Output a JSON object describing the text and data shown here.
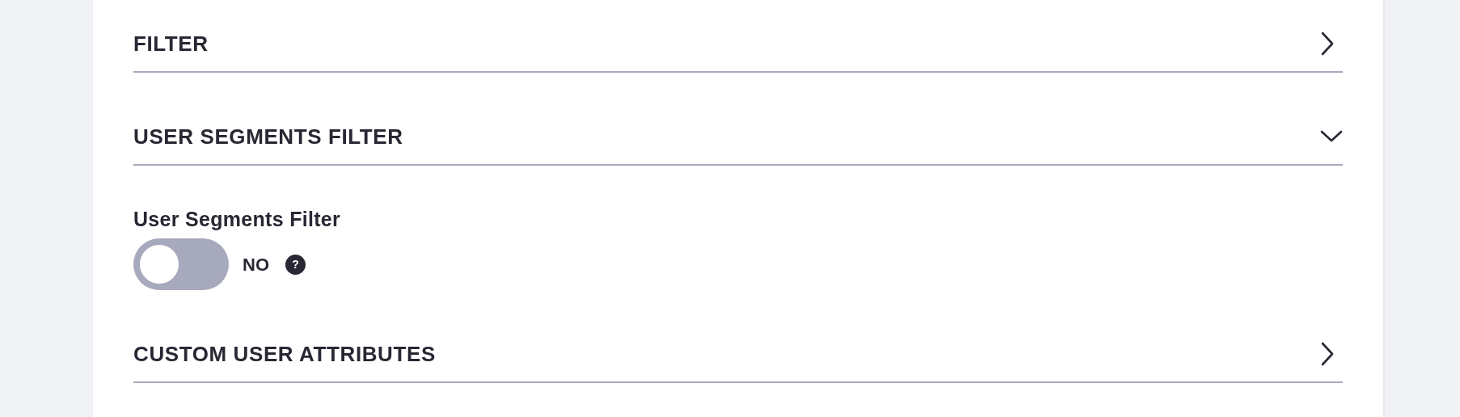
{
  "sections": [
    {
      "title": "FILTER",
      "expanded": false
    },
    {
      "title": "USER SEGMENTS FILTER",
      "expanded": true,
      "fields": [
        {
          "kind": "toggle",
          "label": "User Segments Filter",
          "on": false,
          "state_text": "NO",
          "help": "?"
        }
      ]
    },
    {
      "title": "CUSTOM USER ATTRIBUTES",
      "expanded": false
    }
  ]
}
